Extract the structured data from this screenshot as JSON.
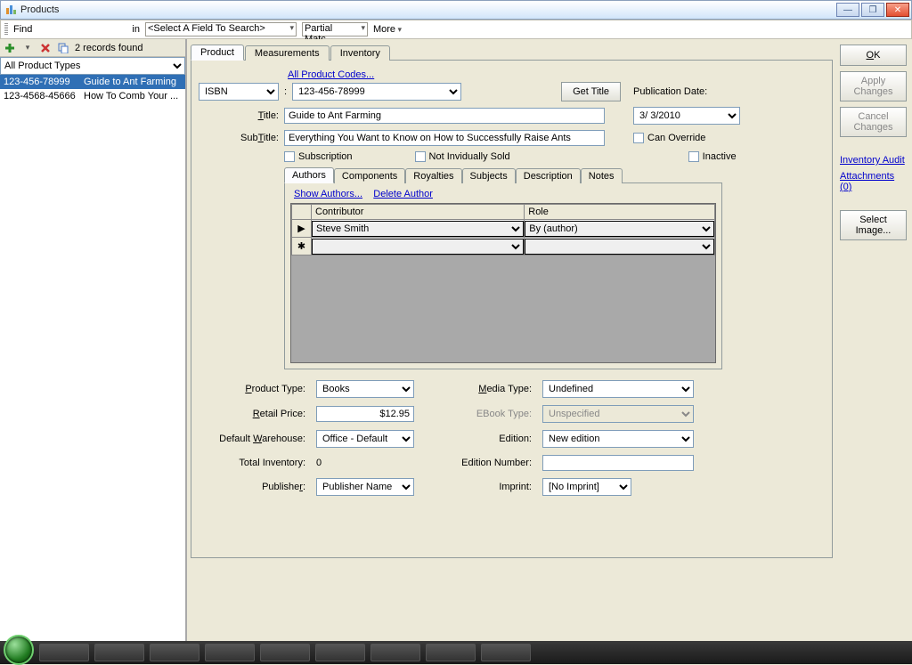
{
  "window": {
    "title": "Products"
  },
  "search": {
    "find_label": "Find",
    "find_value": "",
    "in_label": "in",
    "field_placeholder": "<Select A Field To Search>",
    "match_type": "Partial Matc",
    "more": "More"
  },
  "left": {
    "records_found": "2 records found",
    "filter": "All Product Types",
    "rows": [
      {
        "code": "123-456-78999",
        "title": "Guide to Ant Farming"
      },
      {
        "code": "123-4568-45666",
        "title": "How To Comb Your ..."
      }
    ]
  },
  "tabs": [
    "Product",
    "Measurements",
    "Inventory"
  ],
  "links": {
    "all_codes": "All Product Codes...",
    "get_title": "Get Title",
    "show_authors": "Show Authors...",
    "delete_author": "Delete Author",
    "inventory_audit": "Inventory Audit",
    "attachments": "Attachments (0)"
  },
  "product": {
    "id_type": "ISBN",
    "id_value": "123-456-78999",
    "pub_date_label": "Publication Date:",
    "pub_date": "3/ 3/2010",
    "title_label": "Title:",
    "title": "Guide to Ant Farming",
    "subtitle_label": "SubTitle:",
    "subtitle": "Everything You Want to Know on How to Successfully Raise Ants",
    "can_override": "Can Override",
    "subscription": "Subscription",
    "not_indiv": "Not Invidually Sold",
    "inactive": "Inactive"
  },
  "subtabs": [
    "Authors",
    "Components",
    "Royalties",
    "Subjects",
    "Description",
    "Notes"
  ],
  "authors_grid": {
    "headers": {
      "contributor": "Contributor",
      "role": "Role"
    },
    "row1": {
      "contributor": "Steve Smith",
      "role": "By (author)"
    }
  },
  "bottom": {
    "product_type_l": "Product Type:",
    "product_type": "Books",
    "media_type_l": "Media Type:",
    "media_type": "Undefined",
    "retail_price_l": "Retail Price:",
    "retail_price": "$12.95",
    "ebook_type_l": "EBook Type:",
    "ebook_type": "Unspecified",
    "warehouse_l": "Default Warehouse:",
    "warehouse": "Office - Default",
    "edition_l": "Edition:",
    "edition": "New edition",
    "total_inv_l": "Total Inventory:",
    "total_inv": "0",
    "edition_num_l": "Edition Number:",
    "edition_num": "",
    "publisher_l": "Publisher:",
    "publisher": "Publisher Name",
    "imprint_l": "Imprint:",
    "imprint": "[No Imprint]"
  },
  "sidebar": {
    "ok": "OK",
    "apply": "Apply Changes",
    "cancel": "Cancel Changes",
    "select_image": "Select Image..."
  }
}
